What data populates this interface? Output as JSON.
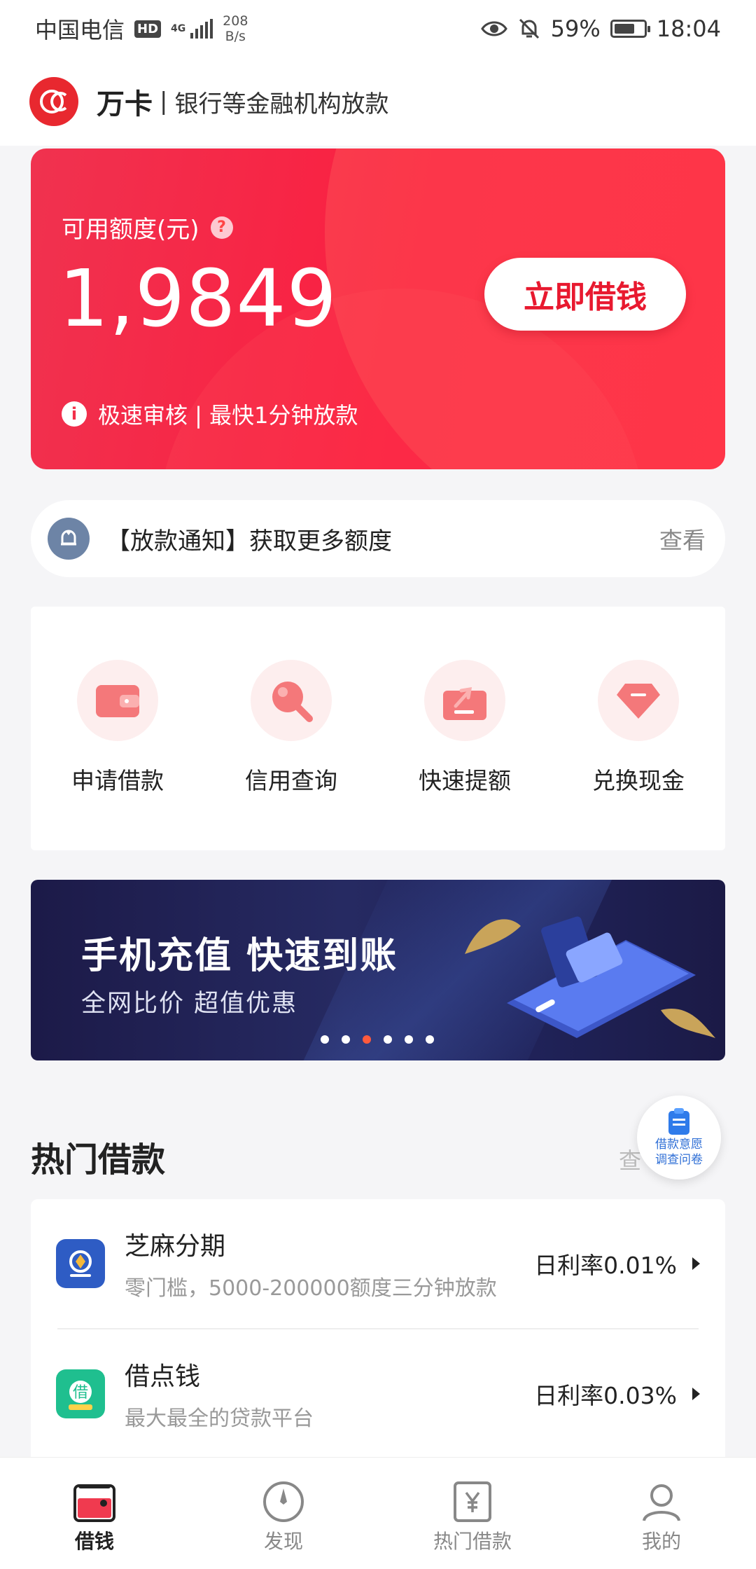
{
  "status_bar": {
    "carrier": "中国电信",
    "hd": "HD",
    "network": "4G",
    "speed_value": "208",
    "speed_unit": "B/s",
    "battery": "59%",
    "time": "18:04"
  },
  "header": {
    "brand": "万卡",
    "separator": "|",
    "subtitle": "银行等金融机构放款"
  },
  "hero": {
    "label": "可用额度(元)",
    "help": "?",
    "amount": "1,9849",
    "button": "立即借钱",
    "tip_icon": "i",
    "tip": "极速审核 | 最快1分钟放款"
  },
  "notice": {
    "text": "【放款通知】获取更多额度",
    "action": "查看"
  },
  "shortcuts": [
    {
      "label": "申请借款",
      "icon": "wallet-icon"
    },
    {
      "label": "信用查询",
      "icon": "search-icon"
    },
    {
      "label": "快速提额",
      "icon": "upload-box-icon"
    },
    {
      "label": "兑换现金",
      "icon": "diamond-icon"
    }
  ],
  "banner": {
    "title": "手机充值 快速到账",
    "subtitle": "全网比价 超值优惠",
    "dots": 6,
    "active_dot": 3
  },
  "hot_loans": {
    "title": "热门借款",
    "more": "查",
    "items": [
      {
        "name": "芝麻分期",
        "desc": "零门槛，5000-200000额度三分钟放款",
        "rate": "日利率0.01%"
      },
      {
        "name": "借点钱",
        "desc": "最大最全的贷款平台",
        "rate": "日利率0.03%"
      }
    ]
  },
  "float_survey": {
    "line1": "借款意愿",
    "line2": "调查问卷"
  },
  "tabs": [
    {
      "label": "借钱",
      "icon": "wallet-tab-icon",
      "active": true
    },
    {
      "label": "发现",
      "icon": "compass-icon",
      "active": false
    },
    {
      "label": "热门借款",
      "icon": "yen-doc-icon",
      "active": false
    },
    {
      "label": "我的",
      "icon": "profile-icon",
      "active": false
    }
  ],
  "colors": {
    "brand_red": "#f0283f",
    "background": "#f5f5f7",
    "banner_dark": "#1c1a48"
  }
}
